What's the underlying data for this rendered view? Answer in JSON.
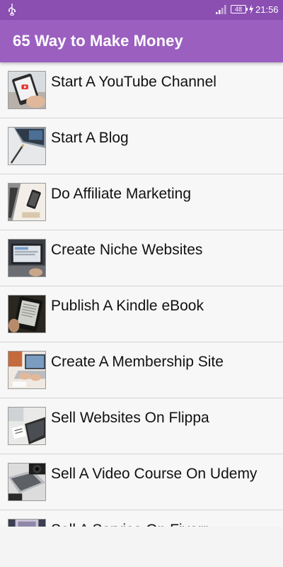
{
  "status_bar": {
    "battery": "48",
    "time": "21:56"
  },
  "app_bar": {
    "title": "65 Way to Make Money"
  },
  "list": {
    "items": [
      {
        "label": "Start A YouTube Channel",
        "icon": "phone-youtube-thumbnail"
      },
      {
        "label": "Start A Blog",
        "icon": "laptop-pen-thumbnail"
      },
      {
        "label": "Do Affiliate Marketing",
        "icon": "laptop-phone-thumbnail"
      },
      {
        "label": "Create Niche Websites",
        "icon": "laptop-screen-thumbnail"
      },
      {
        "label": "Publish A Kindle eBook",
        "icon": "ereader-thumbnail"
      },
      {
        "label": "Create A Membership Site",
        "icon": "laptop-typing-thumbnail"
      },
      {
        "label": "Sell Websites On Flippa",
        "icon": "desk-laptop-thumbnail"
      },
      {
        "label": "Sell A Video Course On Udemy",
        "icon": "laptop-camera-thumbnail"
      },
      {
        "label": "Sell A Service On Fiverr",
        "icon": "tablet-thumbnail"
      }
    ]
  },
  "colors": {
    "status_bar": "#8a4fb0",
    "app_bar": "#9b5fc0",
    "list_background": "#f7f7f7",
    "divider": "#d4d4d4"
  }
}
